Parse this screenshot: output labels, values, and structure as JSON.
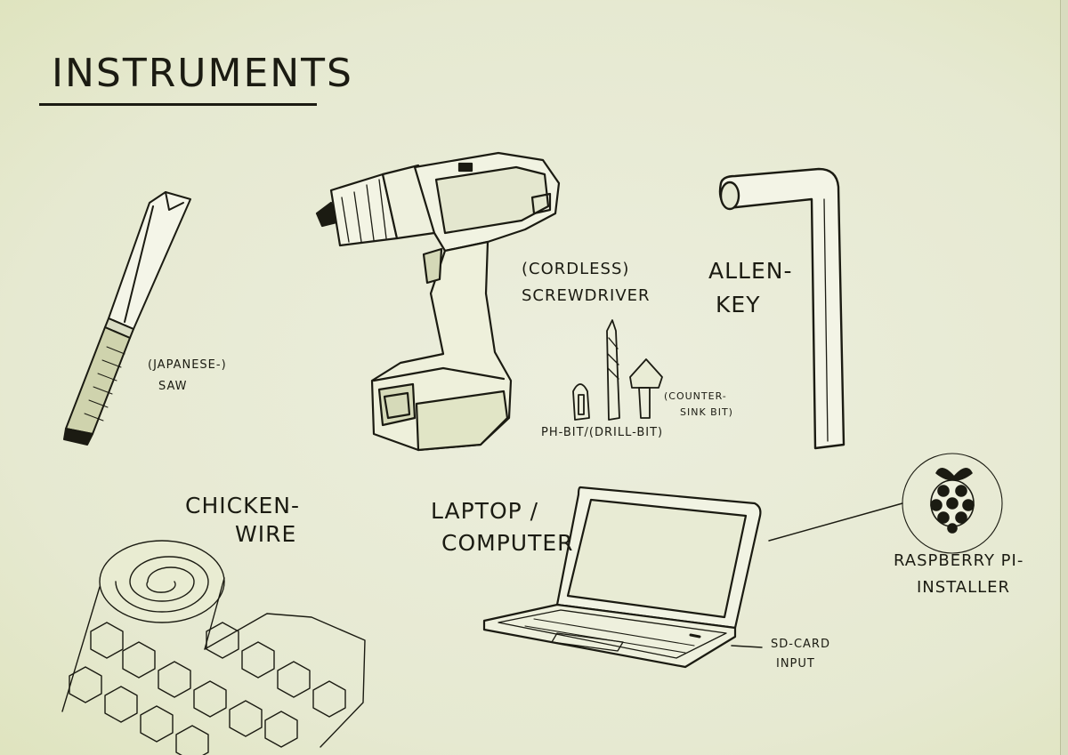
{
  "title": "INSTRUMENTS",
  "labels": {
    "saw_1": "(JAPANESE-)",
    "saw_2": "SAW",
    "drill_1": "(CORDLESS)",
    "drill_2": "SCREWDRIVER",
    "bits": "PH-BIT/(DRILL-BIT)",
    "countersink_1": "(COUNTER-",
    "countersink_2": "SINK BIT)",
    "allen_1": "ALLEN-",
    "allen_2": "KEY",
    "chicken_1": "CHICKEN-",
    "chicken_2": "WIRE",
    "laptop_1": "LAPTOP /",
    "laptop_2": "COMPUTER",
    "raspberry_1": "RASPBERRY PI-",
    "raspberry_2": "INSTALLER",
    "sdcard_1": "SD-CARD",
    "sdcard_2": "INPUT"
  },
  "colors": {
    "ink": "#1b1b12",
    "paper": "#e8ead8",
    "tint": "#dfe4bf"
  },
  "icons": [
    "saw-icon",
    "cordless-screwdriver-icon",
    "ph-bit-icon",
    "drill-bit-icon",
    "countersink-bit-icon",
    "allen-key-icon",
    "chicken-wire-roll-icon",
    "laptop-icon",
    "raspberry-pi-logo-icon"
  ]
}
